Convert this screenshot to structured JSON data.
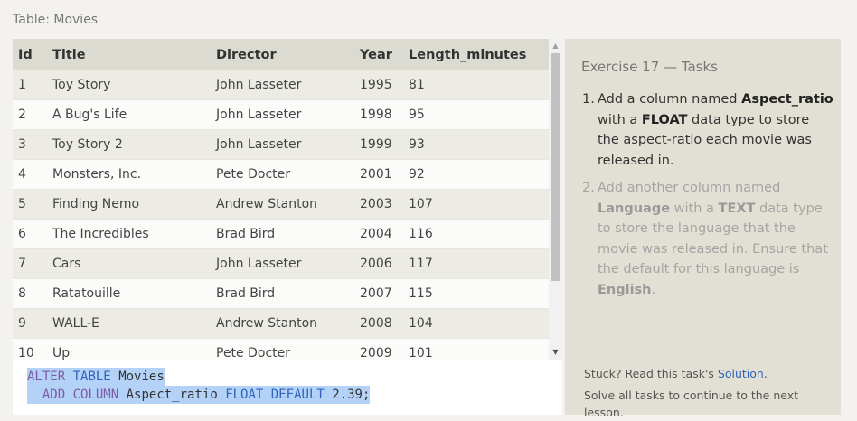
{
  "table_label": "Table: Movies",
  "table": {
    "columns": [
      "Id",
      "Title",
      "Director",
      "Year",
      "Length_minutes"
    ],
    "rows": [
      [
        "1",
        "Toy Story",
        "John Lasseter",
        "1995",
        "81"
      ],
      [
        "2",
        "A Bug's Life",
        "John Lasseter",
        "1998",
        "95"
      ],
      [
        "3",
        "Toy Story 2",
        "John Lasseter",
        "1999",
        "93"
      ],
      [
        "4",
        "Monsters, Inc.",
        "Pete Docter",
        "2001",
        "92"
      ],
      [
        "5",
        "Finding Nemo",
        "Andrew Stanton",
        "2003",
        "107"
      ],
      [
        "6",
        "The Incredibles",
        "Brad Bird",
        "2004",
        "116"
      ],
      [
        "7",
        "Cars",
        "John Lasseter",
        "2006",
        "117"
      ],
      [
        "8",
        "Ratatouille",
        "Brad Bird",
        "2007",
        "115"
      ],
      [
        "9",
        "WALL-E",
        "Andrew Stanton",
        "2008",
        "104"
      ],
      [
        "10",
        "Up",
        "Pete Docter",
        "2009",
        "101"
      ]
    ]
  },
  "scrollbar": {
    "up_icon": "triangle-up-icon",
    "down_icon": "triangle-down-icon"
  },
  "editor": {
    "line1": {
      "kw1": "ALTER",
      "kw2": "TABLE",
      "name": "Movies"
    },
    "line2": {
      "kw1": "ADD",
      "kw2": "COLUMN",
      "name": "Aspect_ratio",
      "type": "FLOAT",
      "kw3": "DEFAULT",
      "value": "2.39;"
    }
  },
  "tasks": {
    "title": "Exercise 17 — Tasks",
    "items": [
      {
        "num": "1.",
        "t1": "Add a column named ",
        "b1": "Aspect_ratio",
        "t2": " with a ",
        "b2": "FLOAT",
        "t3": " data type to store the aspect-ratio each movie was released in."
      },
      {
        "num": "2.",
        "t1": "Add another column named ",
        "b1": "Language",
        "t2": " with a ",
        "b2": "TEXT",
        "t3": " data type to store the language that the movie was released in. Ensure that the default for this language is ",
        "b3": "English",
        "t4": "."
      }
    ],
    "stuck_text": "Stuck? Read this task's ",
    "solution_link": "Solution",
    "stuck_end": ".",
    "solve_note": "Solve all tasks to continue to the next lesson."
  },
  "colors": {
    "accent": "#2f64b8",
    "selection": "#b4d2f7",
    "panel": "#e2e0d4",
    "header": "#dcdbd1"
  }
}
